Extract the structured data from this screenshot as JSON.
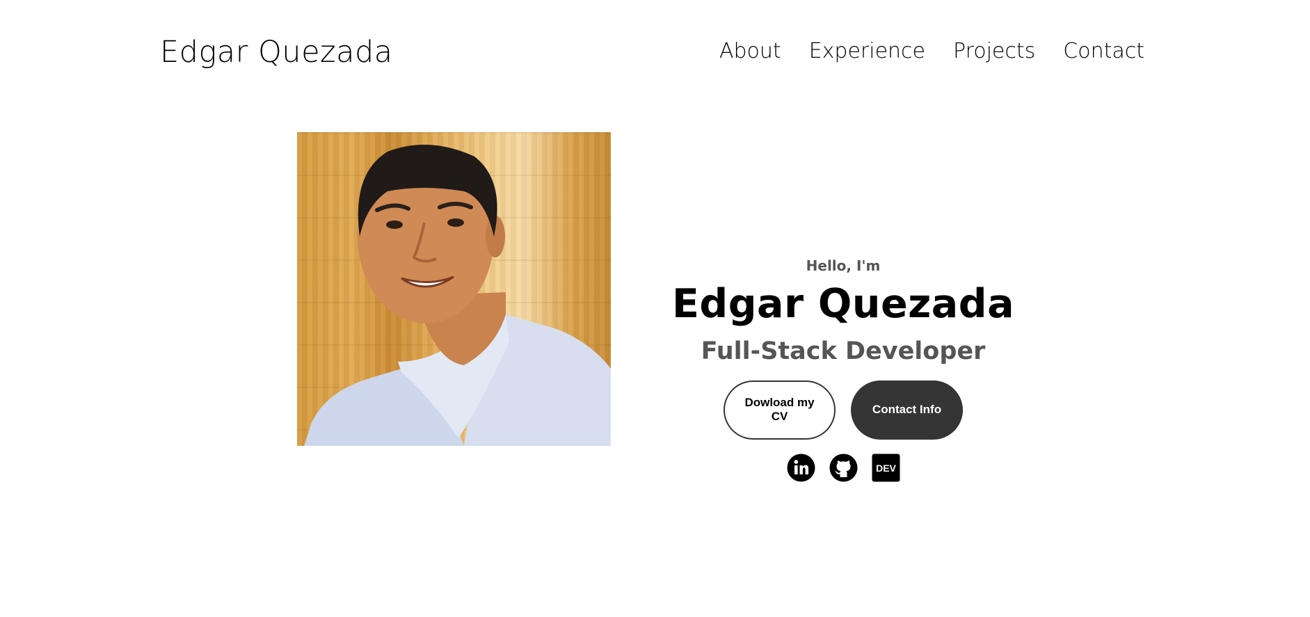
{
  "header": {
    "logo_text": "Edgar Quezada",
    "nav": [
      {
        "label": "About"
      },
      {
        "label": "Experience"
      },
      {
        "label": "Projects"
      },
      {
        "label": "Contact"
      }
    ]
  },
  "hero": {
    "greeting": "Hello, I'm",
    "name": "Edgar Quezada",
    "role": "Full-Stack Developer",
    "buttons": {
      "cv_label": "Dowload my CV",
      "contact_label": "Contact Info"
    },
    "socials": [
      {
        "icon": "linkedin-icon"
      },
      {
        "icon": "github-icon"
      },
      {
        "icon": "dev-icon",
        "text": "DEV"
      }
    ]
  },
  "colors": {
    "text": "#000000",
    "muted_text": "#555555",
    "dark_button": "#353535",
    "background": "#ffffff"
  }
}
